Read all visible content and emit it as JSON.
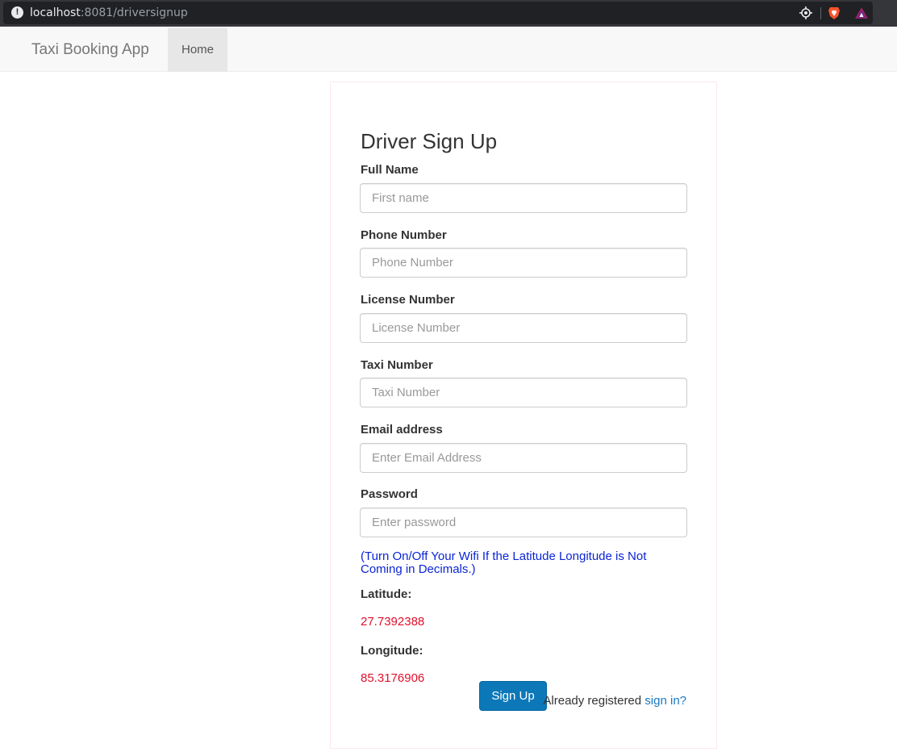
{
  "browser": {
    "url_host": "localhost",
    "url_rest": ":8081/driversignup",
    "info_icon": "info-icon",
    "icons": [
      "location-icon",
      "brave-shield-icon",
      "rewards-icon"
    ]
  },
  "navbar": {
    "brand": "Taxi Booking App",
    "items": [
      {
        "label": "Home",
        "active": true
      }
    ]
  },
  "form": {
    "title": "Driver Sign Up",
    "fields": {
      "full_name": {
        "label": "Full Name",
        "placeholder": "First name",
        "value": ""
      },
      "phone": {
        "label": "Phone Number",
        "placeholder": "Phone Number",
        "value": ""
      },
      "license": {
        "label": "License Number",
        "placeholder": "License Number",
        "value": ""
      },
      "taxi": {
        "label": "Taxi Number",
        "placeholder": "Taxi Number",
        "value": ""
      },
      "email": {
        "label": "Email address",
        "placeholder": "Enter Email Address",
        "value": ""
      },
      "password": {
        "label": "Password",
        "placeholder": "Enter password",
        "value": ""
      }
    },
    "note": "(Turn On/Off Your Wifi If the Latitude Longitude is Not Coming in Decimals.)",
    "latitude_label": "Latitude:",
    "latitude_value": "27.7392388",
    "longitude_label": "Longitude:",
    "longitude_value": "85.3176906",
    "submit_label": "Sign Up",
    "already_text": "Already registered ",
    "signin_link": "sign in?"
  },
  "colors": {
    "accent": "#0c78b8",
    "link": "#1a7abf",
    "note": "#0b24d6",
    "coordinate": "#e0102b",
    "navbar_bg": "#f8f8f8"
  }
}
